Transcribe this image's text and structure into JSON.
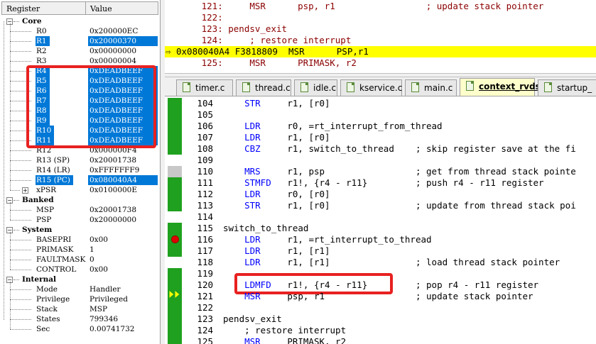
{
  "registers": {
    "header": {
      "name": "Register",
      "value": "Value"
    },
    "groups": [
      {
        "name": "Core",
        "rows": [
          {
            "name": "R0",
            "value": "0x200000EC",
            "selected": false
          },
          {
            "name": "R1",
            "value": "0x20000370",
            "selected": true
          },
          {
            "name": "R2",
            "value": "0x00000000",
            "selected": false
          },
          {
            "name": "R3",
            "value": "0x00000004",
            "selected": false
          },
          {
            "name": "R4",
            "value": "0xDEADBEEF",
            "selected": true
          },
          {
            "name": "R5",
            "value": "0xDEADBEEF",
            "selected": true
          },
          {
            "name": "R6",
            "value": "0xDEADBEEF",
            "selected": true
          },
          {
            "name": "R7",
            "value": "0xDEADBEEF",
            "selected": true
          },
          {
            "name": "R8",
            "value": "0xDEADBEEF",
            "selected": true
          },
          {
            "name": "R9",
            "value": "0xDEADBEEF",
            "selected": true
          },
          {
            "name": "R10",
            "value": "0xDEADBEEF",
            "selected": true
          },
          {
            "name": "R11",
            "value": "0xDEADBEEF",
            "selected": true
          },
          {
            "name": "R12",
            "value": "0x000000F4",
            "selected": false
          },
          {
            "name": "R13 (SP)",
            "value": "0x20001738",
            "selected": false
          },
          {
            "name": "R14 (LR)",
            "value": "0xFFFFFFF9",
            "selected": false
          },
          {
            "name": "R15 (PC)",
            "value": "0x080040A4",
            "selected": true
          },
          {
            "name": "xPSR",
            "value": "0x0100000E",
            "selected": false,
            "expandable": true
          }
        ]
      },
      {
        "name": "Banked",
        "rows": [
          {
            "name": "MSP",
            "value": "0x20001738",
            "selected": false
          },
          {
            "name": "PSP",
            "value": "0x20000000",
            "selected": false
          }
        ]
      },
      {
        "name": "System",
        "rows": [
          {
            "name": "BASEPRI",
            "value": "0x00",
            "selected": false
          },
          {
            "name": "PRIMASK",
            "value": "1",
            "selected": false
          },
          {
            "name": "FAULTMASK",
            "value": "0",
            "selected": false
          },
          {
            "name": "CONTROL",
            "value": "0x00",
            "selected": false
          }
        ]
      },
      {
        "name": "Internal",
        "rows": [
          {
            "name": "Mode",
            "value": "Handler",
            "selected": false
          },
          {
            "name": "Privilege",
            "value": "Privileged",
            "selected": false
          },
          {
            "name": "Stack",
            "value": "MSP",
            "selected": false
          },
          {
            "name": "States",
            "value": "799346",
            "selected": false
          },
          {
            "name": "Sec",
            "value": "0.00741732",
            "selected": false
          }
        ]
      }
    ]
  },
  "disassembly": {
    "lines": [
      {
        "text": "     121:     MSR      psp, r1                 ; update stack pointer",
        "current": false
      },
      {
        "text": "     122:",
        "current": false
      },
      {
        "text": "     123: pendsv_exit",
        "current": false
      },
      {
        "text": "     124:     ; restore interrupt",
        "current": false
      },
      {
        "text": "0x080040A4 F3818809  MSR      PSP,r1",
        "current": true
      },
      {
        "text": "     125:     MSR      PRIMASK, r2",
        "current": false
      }
    ]
  },
  "tabs": [
    {
      "label": "timer.c",
      "active": false
    },
    {
      "label": "thread.c",
      "active": false
    },
    {
      "label": "idle.c",
      "active": false
    },
    {
      "label": "kservice.c",
      "active": false
    },
    {
      "label": "main.c",
      "active": false
    },
    {
      "label": "context_rvds.S",
      "active": true
    },
    {
      "label": "startup_",
      "active": false
    }
  ],
  "editor": {
    "lines": [
      {
        "num": "104",
        "text": "    STR     r1, [r0]"
      },
      {
        "num": "105",
        "text": ""
      },
      {
        "num": "106",
        "text": "    LDR     r0, =rt_interrupt_from_thread"
      },
      {
        "num": "107",
        "text": "    LDR     r1, [r0]"
      },
      {
        "num": "108",
        "text": "    CBZ     r1, switch_to_thread    ; skip register save at the fi"
      },
      {
        "num": "109",
        "text": ""
      },
      {
        "num": "110",
        "text": "    MRS     r1, psp                 ; get from thread stack pointe"
      },
      {
        "num": "111",
        "text": "    STMFD   r1!, {r4 - r11}         ; push r4 - r11 register"
      },
      {
        "num": "112",
        "text": "    LDR     r0, [r0]"
      },
      {
        "num": "113",
        "text": "    STR     r1, [r0]                ; update from thread stack poi"
      },
      {
        "num": "114",
        "text": ""
      },
      {
        "num": "115",
        "text": "switch_to_thread"
      },
      {
        "num": "116",
        "text": "    LDR     r1, =rt_interrupt_to_thread"
      },
      {
        "num": "117",
        "text": "    LDR     r1, [r1]"
      },
      {
        "num": "118",
        "text": "    LDR     r1, [r1]                ; load thread stack pointer"
      },
      {
        "num": "119",
        "text": ""
      },
      {
        "num": "120",
        "text": "    LDMFD   r1!, {r4 - r11}         ; pop r4 - r11 register"
      },
      {
        "num": "121",
        "text": "    MSR     psp, r1                 ; update stack pointer"
      },
      {
        "num": "122",
        "text": ""
      },
      {
        "num": "123",
        "text": "pendsv_exit"
      },
      {
        "num": "124",
        "text": "    ; restore interrupt"
      },
      {
        "num": "125",
        "text": "    MSR     PRIMASK, r2"
      }
    ],
    "mnemonics": [
      "STR",
      "LDR",
      "CBZ",
      "MRS",
      "STMFD",
      "LDMFD",
      "MSR"
    ]
  },
  "colors": {
    "selection": "#0078d7",
    "highlight_box": "#e82121",
    "current_line": "#ffff00",
    "coverage": "#1fa11f",
    "keyword": "#0000ff"
  }
}
